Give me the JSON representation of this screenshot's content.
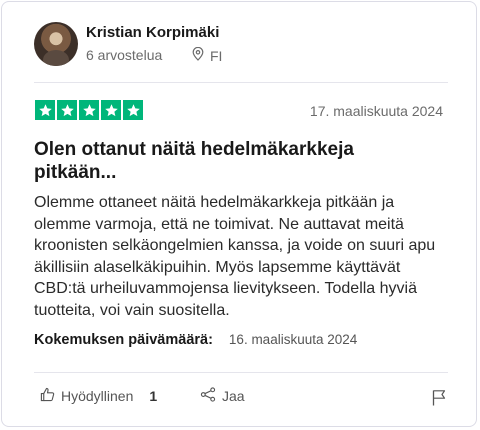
{
  "reviewer": {
    "name": "Kristian Korpimäki",
    "review_count": "6 arvostelua",
    "country": "FI"
  },
  "rating": {
    "stars": 5,
    "max": 5,
    "color": "#00b67a"
  },
  "review": {
    "date": "17. maaliskuuta 2024",
    "title": "Olen ottanut näitä hedelmäkarkkeja pitkään...",
    "body": "Olemme ottaneet näitä hedelmäkarkkeja pitkään ja olemme varmoja, että ne toimivat. Ne auttavat meitä kroonisten selkäongelmien kanssa, ja voide on suuri apu äkillisiin alaselkäkipuihin. Myös lapsemme käyttävät CBD:tä urheiluvammojensa lievitykseen. Todella hyviä tuotteita, voi vain suositella."
  },
  "experience": {
    "label": "Kokemuksen päivämäärä:",
    "date": "16. maaliskuuta 2024"
  },
  "actions": {
    "useful_label": "Hyödyllinen",
    "useful_count": "1",
    "share_label": "Jaa"
  },
  "icons": {
    "location": "location-pin-icon",
    "useful": "thumbs-up-icon",
    "share": "share-icon",
    "flag": "flag-icon",
    "star": "star-icon"
  }
}
